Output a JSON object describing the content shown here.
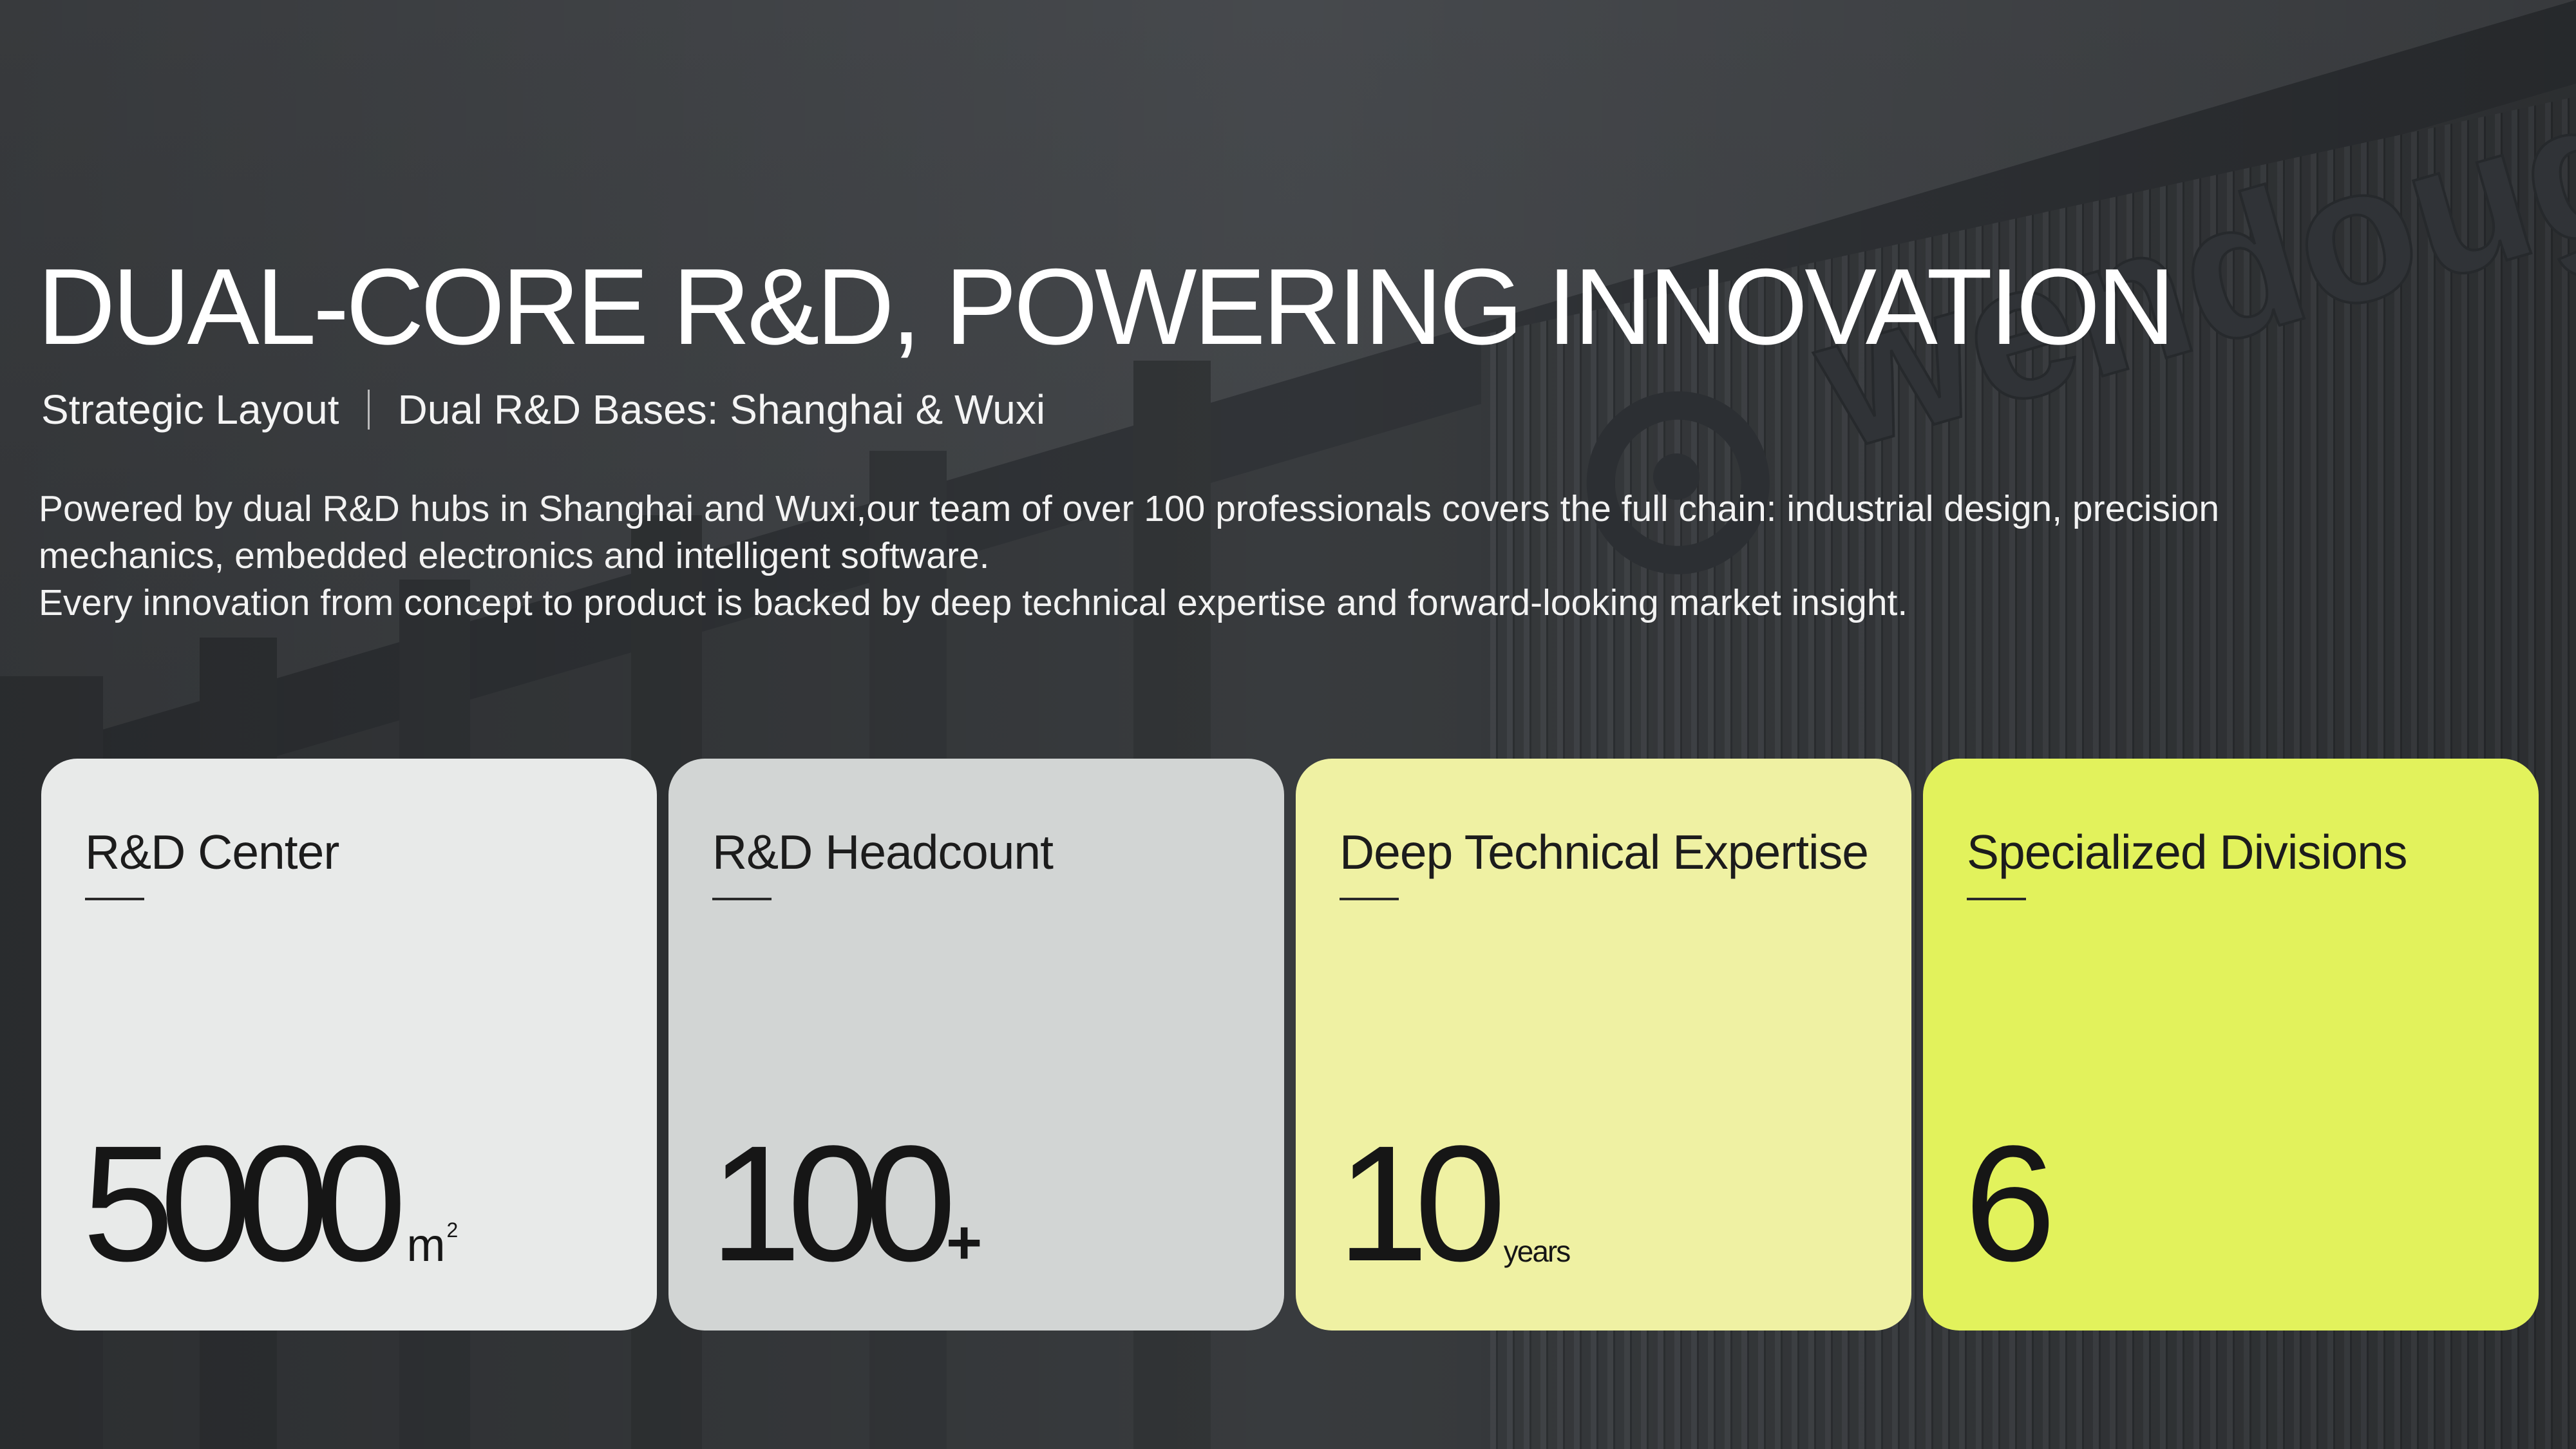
{
  "header": {
    "title": "DUAL-CORE R&D, POWERING INNOVATION",
    "subtitle_left": "Strategic Layout",
    "subtitle_right": "Dual R&D Bases: Shanghai & Wuxi"
  },
  "description": {
    "line1": "Powered by dual R&D hubs in Shanghai and Wuxi,our team of over 100 professionals covers the full chain: industrial design, precision mechanics, embedded electronics and intelligent software.",
    "line2": "Every innovation from concept to product is backed by deep technical expertise and forward-looking market insight."
  },
  "background": {
    "brand_text": "wendouge",
    "logo_icon": "brand-logo-icon"
  },
  "colors": {
    "card1": "#e8eae9",
    "card2": "#d2d5d4",
    "card3": "#eff1a3",
    "card4": "#e2f25c",
    "background": "#3f4245"
  },
  "stats": [
    {
      "title": "R&D Center",
      "value": "5000",
      "unit": "m",
      "unit_sup": "2"
    },
    {
      "title": "R&D Headcount",
      "value": "100",
      "unit": "+"
    },
    {
      "title": "Deep Technical Expertise",
      "value": "10",
      "unit": "years"
    },
    {
      "title": "Specialized Divisions",
      "value": "6"
    }
  ]
}
